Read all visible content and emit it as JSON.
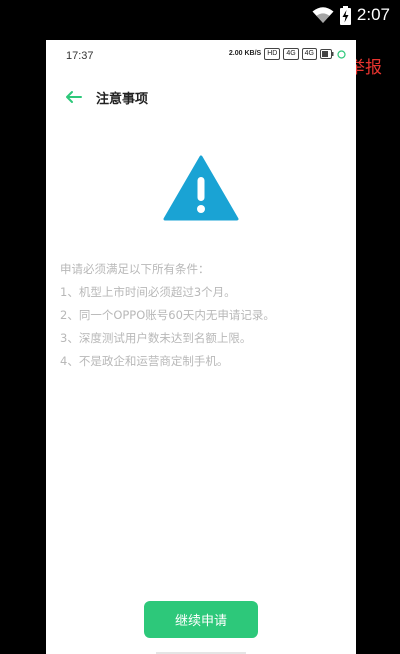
{
  "outer_status": {
    "time": "2:07",
    "icons": [
      "wifi-icon",
      "battery-charging-icon"
    ]
  },
  "inner_status": {
    "time": "17:37",
    "indicators": [
      "2.00 KB/S",
      "HD",
      "4G",
      "4G",
      "battery"
    ]
  },
  "report_label": "举报",
  "nav": {
    "back_icon": "arrow-left-icon",
    "title": "注意事项"
  },
  "warning_icon": "warning-triangle-icon",
  "conditions": {
    "heading": "申请必须满足以下所有条件：",
    "items": [
      "1、机型上市时间必须超过3个月。",
      "2、同一个OPPO账号60天内无申请记录。",
      "3、深度测试用户数未达到名额上限。",
      "4、不是政企和运营商定制手机。"
    ]
  },
  "continue_button": "继续申请",
  "colors": {
    "accent": "#2dc87a",
    "warning": "#1aa3d4",
    "report": "#e8342f",
    "muted_text": "#b8b8b8"
  }
}
